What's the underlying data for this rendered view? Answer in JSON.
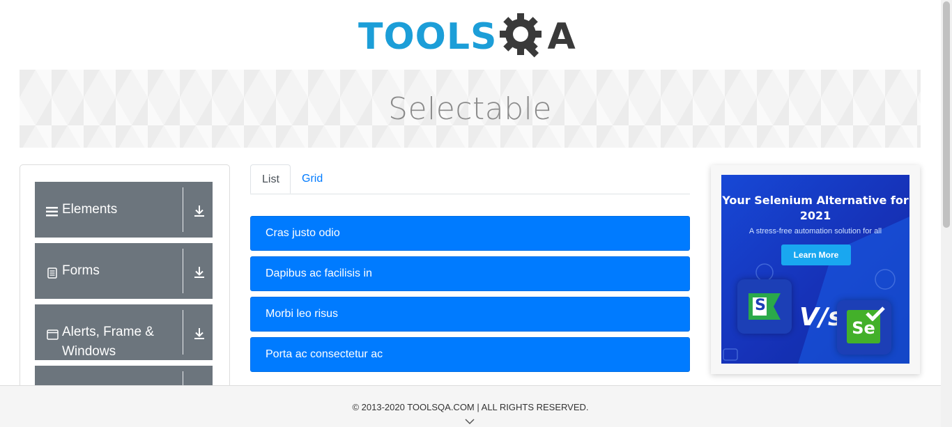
{
  "header": {
    "logo_tools": "TOOLS",
    "logo_q_icon": "gear-magnifier-icon",
    "logo_a": "A"
  },
  "banner": {
    "title": "Selectable"
  },
  "sidebar": {
    "groups": [
      {
        "label": "Elements",
        "icon": "hamburger-icon"
      },
      {
        "label": "Forms",
        "icon": "document-icon"
      },
      {
        "label": "Alerts, Frame & Windows",
        "icon": "window-icon"
      },
      {
        "label": "",
        "icon": ""
      }
    ],
    "group_action_icon": "download-arrow-icon"
  },
  "tabs": [
    {
      "label": "List",
      "active": true
    },
    {
      "label": "Grid",
      "active": false
    }
  ],
  "list": {
    "items": [
      "Cras justo odio",
      "Dapibus ac facilisis in",
      "Morbi leo risus",
      "Porta ac consectetur ac"
    ]
  },
  "ad": {
    "title": "Your Selenium Alternative for 2021",
    "subtitle": "A stress-free automation solution for all",
    "button": "Learn More",
    "vs": "V/s",
    "left_logo": "S",
    "right_logo": "Se"
  },
  "footer": {
    "text": "© 2013-2020 TOOLSQA.COM | ALL RIGHTS RESERVED."
  },
  "colors": {
    "accent": "#007bff",
    "sidebar_group": "#6c757d",
    "logo_blue": "#1c9ed8",
    "logo_dark": "#3a3a3a",
    "ad_bg": "#1748d6",
    "ad_button": "#19a7f0"
  }
}
